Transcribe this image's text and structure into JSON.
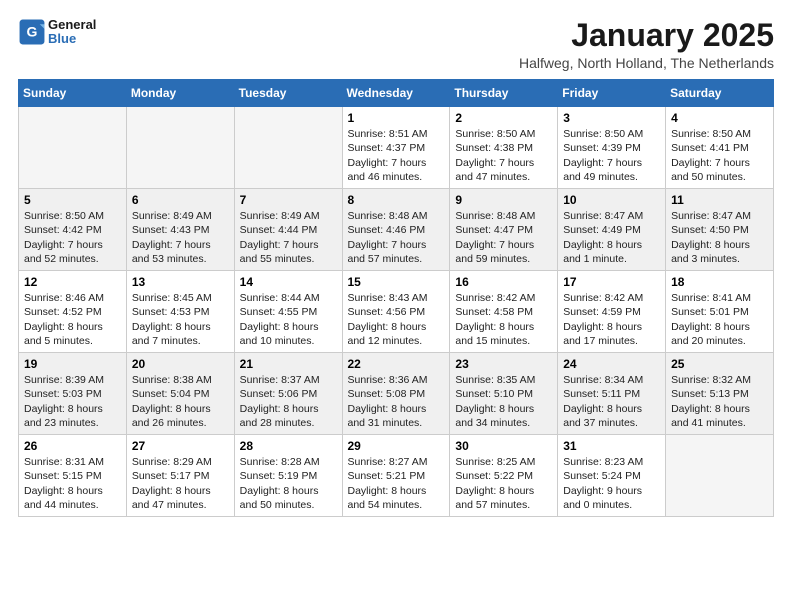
{
  "header": {
    "logo_line1": "General",
    "logo_line2": "Blue",
    "month": "January 2025",
    "location": "Halfweg, North Holland, The Netherlands"
  },
  "weekdays": [
    "Sunday",
    "Monday",
    "Tuesday",
    "Wednesday",
    "Thursday",
    "Friday",
    "Saturday"
  ],
  "weeks": [
    [
      {
        "day": "",
        "info": ""
      },
      {
        "day": "",
        "info": ""
      },
      {
        "day": "",
        "info": ""
      },
      {
        "day": "1",
        "info": "Sunrise: 8:51 AM\nSunset: 4:37 PM\nDaylight: 7 hours and 46 minutes."
      },
      {
        "day": "2",
        "info": "Sunrise: 8:50 AM\nSunset: 4:38 PM\nDaylight: 7 hours and 47 minutes."
      },
      {
        "day": "3",
        "info": "Sunrise: 8:50 AM\nSunset: 4:39 PM\nDaylight: 7 hours and 49 minutes."
      },
      {
        "day": "4",
        "info": "Sunrise: 8:50 AM\nSunset: 4:41 PM\nDaylight: 7 hours and 50 minutes."
      }
    ],
    [
      {
        "day": "5",
        "info": "Sunrise: 8:50 AM\nSunset: 4:42 PM\nDaylight: 7 hours and 52 minutes."
      },
      {
        "day": "6",
        "info": "Sunrise: 8:49 AM\nSunset: 4:43 PM\nDaylight: 7 hours and 53 minutes."
      },
      {
        "day": "7",
        "info": "Sunrise: 8:49 AM\nSunset: 4:44 PM\nDaylight: 7 hours and 55 minutes."
      },
      {
        "day": "8",
        "info": "Sunrise: 8:48 AM\nSunset: 4:46 PM\nDaylight: 7 hours and 57 minutes."
      },
      {
        "day": "9",
        "info": "Sunrise: 8:48 AM\nSunset: 4:47 PM\nDaylight: 7 hours and 59 minutes."
      },
      {
        "day": "10",
        "info": "Sunrise: 8:47 AM\nSunset: 4:49 PM\nDaylight: 8 hours and 1 minute."
      },
      {
        "day": "11",
        "info": "Sunrise: 8:47 AM\nSunset: 4:50 PM\nDaylight: 8 hours and 3 minutes."
      }
    ],
    [
      {
        "day": "12",
        "info": "Sunrise: 8:46 AM\nSunset: 4:52 PM\nDaylight: 8 hours and 5 minutes."
      },
      {
        "day": "13",
        "info": "Sunrise: 8:45 AM\nSunset: 4:53 PM\nDaylight: 8 hours and 7 minutes."
      },
      {
        "day": "14",
        "info": "Sunrise: 8:44 AM\nSunset: 4:55 PM\nDaylight: 8 hours and 10 minutes."
      },
      {
        "day": "15",
        "info": "Sunrise: 8:43 AM\nSunset: 4:56 PM\nDaylight: 8 hours and 12 minutes."
      },
      {
        "day": "16",
        "info": "Sunrise: 8:42 AM\nSunset: 4:58 PM\nDaylight: 8 hours and 15 minutes."
      },
      {
        "day": "17",
        "info": "Sunrise: 8:42 AM\nSunset: 4:59 PM\nDaylight: 8 hours and 17 minutes."
      },
      {
        "day": "18",
        "info": "Sunrise: 8:41 AM\nSunset: 5:01 PM\nDaylight: 8 hours and 20 minutes."
      }
    ],
    [
      {
        "day": "19",
        "info": "Sunrise: 8:39 AM\nSunset: 5:03 PM\nDaylight: 8 hours and 23 minutes."
      },
      {
        "day": "20",
        "info": "Sunrise: 8:38 AM\nSunset: 5:04 PM\nDaylight: 8 hours and 26 minutes."
      },
      {
        "day": "21",
        "info": "Sunrise: 8:37 AM\nSunset: 5:06 PM\nDaylight: 8 hours and 28 minutes."
      },
      {
        "day": "22",
        "info": "Sunrise: 8:36 AM\nSunset: 5:08 PM\nDaylight: 8 hours and 31 minutes."
      },
      {
        "day": "23",
        "info": "Sunrise: 8:35 AM\nSunset: 5:10 PM\nDaylight: 8 hours and 34 minutes."
      },
      {
        "day": "24",
        "info": "Sunrise: 8:34 AM\nSunset: 5:11 PM\nDaylight: 8 hours and 37 minutes."
      },
      {
        "day": "25",
        "info": "Sunrise: 8:32 AM\nSunset: 5:13 PM\nDaylight: 8 hours and 41 minutes."
      }
    ],
    [
      {
        "day": "26",
        "info": "Sunrise: 8:31 AM\nSunset: 5:15 PM\nDaylight: 8 hours and 44 minutes."
      },
      {
        "day": "27",
        "info": "Sunrise: 8:29 AM\nSunset: 5:17 PM\nDaylight: 8 hours and 47 minutes."
      },
      {
        "day": "28",
        "info": "Sunrise: 8:28 AM\nSunset: 5:19 PM\nDaylight: 8 hours and 50 minutes."
      },
      {
        "day": "29",
        "info": "Sunrise: 8:27 AM\nSunset: 5:21 PM\nDaylight: 8 hours and 54 minutes."
      },
      {
        "day": "30",
        "info": "Sunrise: 8:25 AM\nSunset: 5:22 PM\nDaylight: 8 hours and 57 minutes."
      },
      {
        "day": "31",
        "info": "Sunrise: 8:23 AM\nSunset: 5:24 PM\nDaylight: 9 hours and 0 minutes."
      },
      {
        "day": "",
        "info": ""
      }
    ]
  ]
}
